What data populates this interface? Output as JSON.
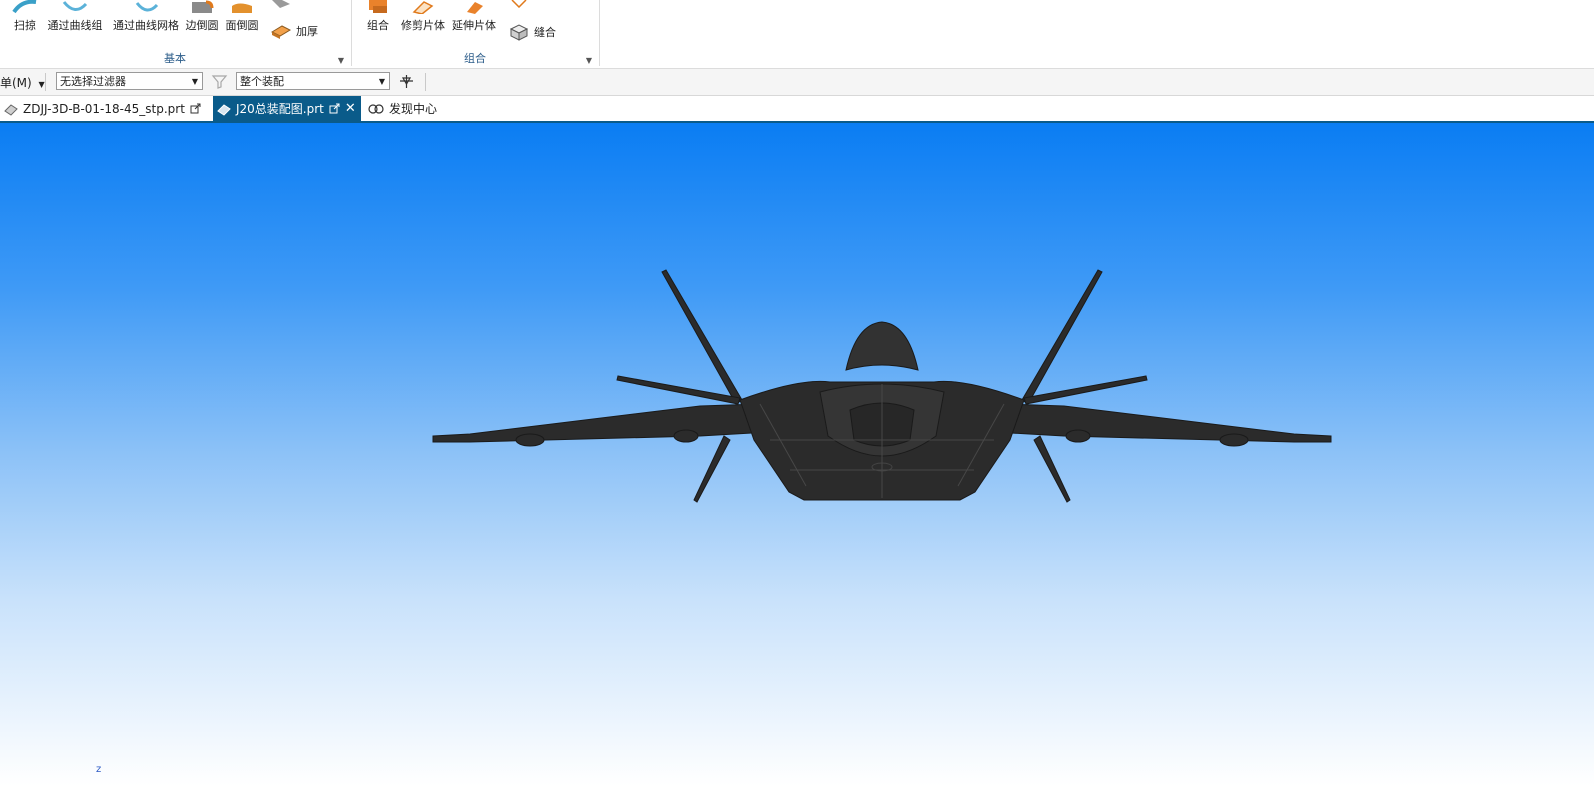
{
  "ribbon": {
    "groups": [
      {
        "label": "基本",
        "buttons": [
          "扫掠",
          "通过曲线组",
          "通过曲线网格",
          "边倒圆",
          "面倒圆",
          "加厚"
        ]
      },
      {
        "label": "组合",
        "buttons": [
          "组合",
          "修剪片体",
          "延伸片体",
          "缝合"
        ]
      }
    ]
  },
  "selbar": {
    "menu_label": "单(M)",
    "filter_value": "无选择过滤器",
    "scope_value": "整个装配"
  },
  "tabs": [
    {
      "label": "ZDJJ-3D-B-01-18-45_stp.prt",
      "active": false
    },
    {
      "label": "J20总装配图.prt",
      "active": true
    },
    {
      "label": "发现中心",
      "active": false
    }
  ],
  "viewport": {
    "triad_label": "z",
    "colors": {
      "sky_top": "#0a7df3",
      "sky_bottom": "#ffffff",
      "model": "#2b2b2b"
    }
  }
}
